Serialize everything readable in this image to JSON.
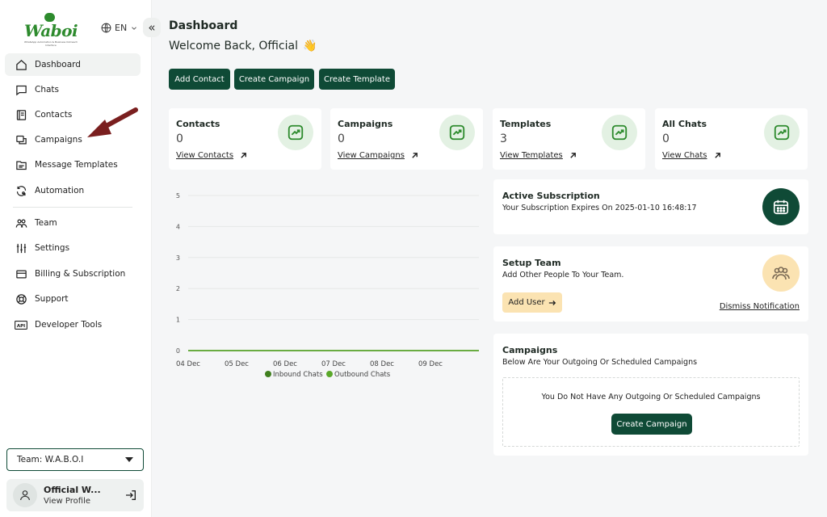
{
  "brand": {
    "logo_text": "Waboi",
    "logo_tagline": "WhatsApp Automation & Business Outreach Interface"
  },
  "lang": {
    "label": "EN"
  },
  "sidebar": {
    "collapse_glyph": "«",
    "items": [
      {
        "label": "Dashboard",
        "icon": "home-icon",
        "active": true
      },
      {
        "label": "Chats",
        "icon": "chat-icon"
      },
      {
        "label": "Contacts",
        "icon": "contacts-icon"
      },
      {
        "label": "Campaigns",
        "icon": "campaigns-icon"
      },
      {
        "label": "Message Templates",
        "icon": "template-icon"
      },
      {
        "label": "Automation",
        "icon": "automation-icon"
      },
      {
        "label": "Team",
        "icon": "team-icon"
      },
      {
        "label": "Settings",
        "icon": "settings-icon"
      },
      {
        "label": "Billing & Subscription",
        "icon": "billing-icon"
      },
      {
        "label": "Support",
        "icon": "support-icon"
      },
      {
        "label": "Developer Tools",
        "icon": "api-icon"
      }
    ],
    "team_select": "Team: W.A.B.O.I",
    "profile": {
      "name": "Official W...",
      "link": "View Profile"
    }
  },
  "header": {
    "title": "Dashboard",
    "welcome": "Welcome Back, Official",
    "wave": "👋"
  },
  "actions": [
    "Add Contact",
    "Create Campaign",
    "Create Template"
  ],
  "stats": [
    {
      "label": "Contacts",
      "value": "0",
      "link": "View Contacts"
    },
    {
      "label": "Campaigns",
      "value": "0",
      "link": "View Campaigns"
    },
    {
      "label": "Templates",
      "value": "3",
      "link": "View Templates"
    },
    {
      "label": "All Chats",
      "value": "0",
      "link": "View Chats"
    }
  ],
  "chart_data": {
    "type": "line",
    "x": [
      "04 Dec",
      "05 Dec",
      "06 Dec",
      "07 Dec",
      "08 Dec",
      "09 Dec"
    ],
    "series": [
      {
        "name": "Inbound Chats",
        "values": [
          0,
          0,
          0,
          0,
          0,
          0
        ],
        "color": "#3f7f1e"
      },
      {
        "name": "Outbound Chats",
        "values": [
          0,
          0,
          0,
          0,
          0,
          0
        ],
        "color": "#5aa82a"
      }
    ],
    "ylim": [
      0,
      5
    ],
    "yticks": [
      "0",
      "1",
      "2",
      "3",
      "4",
      "5"
    ],
    "grid": true,
    "legend": "bottom"
  },
  "subscription": {
    "title": "Active Subscription",
    "text": "Your Subscription Expires On 2025-01-10 16:48:17"
  },
  "setup_team": {
    "title": "Setup Team",
    "text": "Add Other People To Your Team.",
    "button": "Add User",
    "dismiss": "Dismiss Notification"
  },
  "campaigns_card": {
    "title": "Campaigns",
    "subtitle": "Below Are Your Outgoing Or Scheduled Campaigns",
    "empty": "You Do Not Have Any Outgoing Or Scheduled Campaigns",
    "button": "Create Campaign"
  },
  "colors": {
    "primary": "#0f4a36",
    "accent_green": "#2e8b2e",
    "soft_yellow": "#fbe3b2"
  }
}
